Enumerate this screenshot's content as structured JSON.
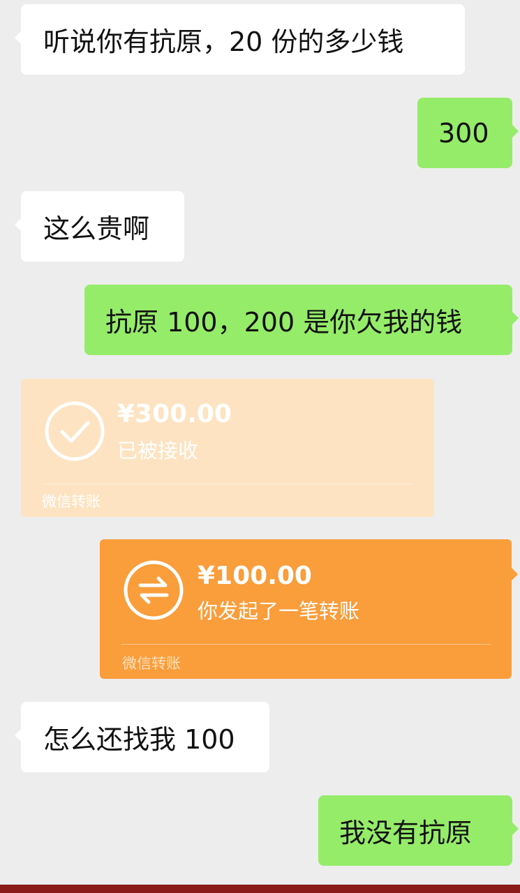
{
  "messages": [
    {
      "side": "left",
      "text": "听说你有抗原，20 份的多少钱"
    },
    {
      "side": "right",
      "text": "300"
    },
    {
      "side": "left",
      "text": "这么贵啊"
    },
    {
      "side": "right",
      "text": "抗原 100，200 是你欠我的钱"
    },
    {
      "side": "left",
      "type": "transfer",
      "amount": "¥300.00",
      "status": "已被接收",
      "brand": "微信转账",
      "icon": "check-circle-icon"
    },
    {
      "side": "right",
      "type": "transfer",
      "amount": "¥100.00",
      "status": "你发起了一笔转账",
      "brand": "微信转账",
      "icon": "transfer-arrows-icon"
    },
    {
      "side": "left",
      "text": "怎么还找我 100"
    },
    {
      "side": "right",
      "text": "我没有抗原"
    }
  ],
  "colors": {
    "background": "#ededed",
    "incoming_bubble": "#ffffff",
    "outgoing_bubble": "#95ec69",
    "transfer_received": "#fde3c1",
    "transfer_sent": "#fa9d3b",
    "bottom_bar": "#8b1a1a"
  }
}
